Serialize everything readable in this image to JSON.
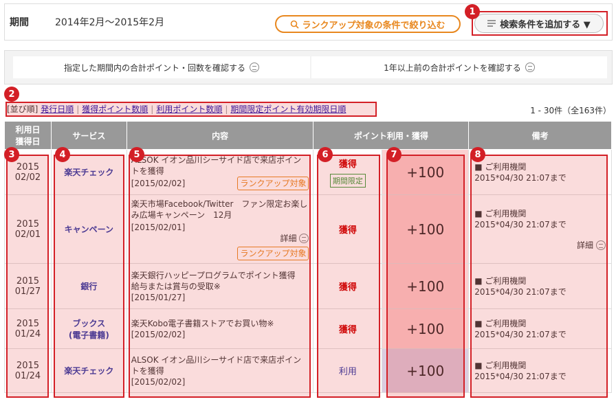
{
  "period": {
    "label": "期間",
    "value": "2014年2月〜2015年2月"
  },
  "filter_button": "ランクアップ対象の条件で絞り込む",
  "add_condition_button": "検索条件を追加する ▼",
  "confirm": {
    "current": "指定した期間内の合計ポイント・回数を確認する",
    "older": "1年以上前の合計ポイントを確認する"
  },
  "sort": {
    "prefix": "[並び順]",
    "options": [
      "発行日順",
      "獲得ポイント数順",
      "利用ポイント数順",
      "期間限定ポイント有効期限日順"
    ]
  },
  "result_count": "1 - 30件（全163件）",
  "table": {
    "headers": {
      "date_line1": "利用日",
      "date_line2": "獲得日",
      "service": "サービス",
      "content": "内容",
      "points": "ポイント利用・獲得",
      "remarks": "備考"
    },
    "rows": [
      {
        "year": "2015",
        "md": "02/02",
        "service": "楽天チェック",
        "content": "ALSOK イオン品川シーサイド店で来店ポイントを獲得",
        "date": "[2015/02/02]",
        "rankup": "ランクアップ対象",
        "type": "獲得",
        "limited": "期間限定",
        "points": "+100",
        "note_title": "■ ご利用機関",
        "note_date": "2015*04/30 21:07まで"
      },
      {
        "year": "2015",
        "md": "02/01",
        "service": "キャンペーン",
        "content": "楽天市場Facebook/Twitter　ファン限定お楽しみ広場キャンペーン　12月",
        "date": "[2015/02/01]",
        "detail": "詳細",
        "rankup": "ランクアップ対象",
        "type": "獲得",
        "points": "+100",
        "note_title": "■ ご利用機関",
        "note_date": "2015*04/30 21:07まで",
        "note_detail": "詳細"
      },
      {
        "year": "2015",
        "md": "01/27",
        "service": "銀行",
        "content": "楽天銀行ハッピープログラムでポイント獲得　給与または賞与の受取※",
        "date": "[2015/01/27]",
        "type": "獲得",
        "points": "+100",
        "note_title": "■ ご利用機関",
        "note_date": "2015*04/30 21:07まで"
      },
      {
        "year": "2015",
        "md": "01/24",
        "service": "ブックス\n(電子書籍)",
        "service_line1": "ブックス",
        "service_line2": "(電子書籍)",
        "content": "楽天Kobo電子書籍ストアでお買い物※",
        "date": "[2015/02/02]",
        "type": "獲得",
        "points": "+100",
        "note_title": "■ ご利用機関",
        "note_date": "2015*04/30 21:07まで"
      },
      {
        "year": "2015",
        "md": "01/24",
        "service": "楽天チェック",
        "content": "ALSOK イオン品川シーサイド店で来店ポイントを獲得",
        "date": "[2015/02/02]",
        "type": "利用",
        "points": "+100",
        "note_title": "■ ご利用機関",
        "note_date": "2015*04/30 21:07まで"
      }
    ]
  },
  "badges": [
    "1",
    "2",
    "3",
    "4",
    "5",
    "6",
    "7",
    "8"
  ],
  "colors": {
    "accent_orange": "#e8871e",
    "highlight_red": "#d31f26",
    "earn_red": "#cc0000",
    "service_blue": "#2b3aa6",
    "header_gray": "#999999"
  }
}
